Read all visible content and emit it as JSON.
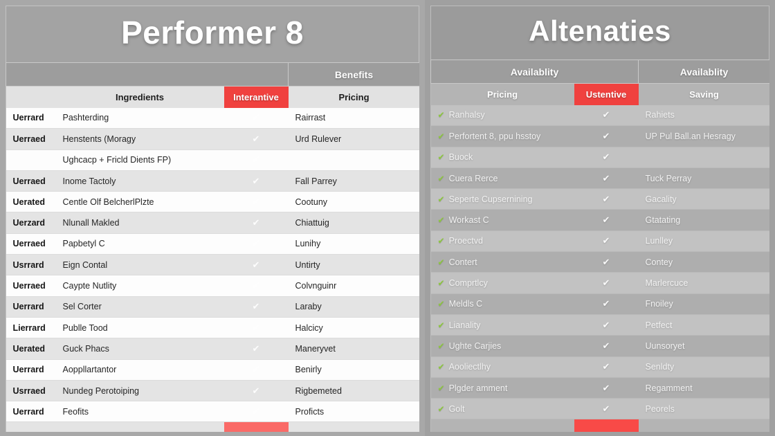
{
  "left_panel": {
    "title": "Performer 8",
    "group_headers": [
      {
        "label": "",
        "span": 3
      },
      {
        "label": "Benefits",
        "span": 1
      }
    ],
    "columns": [
      {
        "label": "",
        "key": "tag"
      },
      {
        "label": "Ingredients",
        "key": "ingredient"
      },
      {
        "label": "Interantive",
        "key": "check",
        "highlight": true,
        "color": "#f0413f"
      },
      {
        "label": "Pricing",
        "key": "pricing"
      }
    ],
    "check_glyph": "✔",
    "rows": [
      {
        "tag": "Uerrard",
        "ingredient": "Pashterding",
        "check": "✔",
        "pricing": "Rairrast"
      },
      {
        "tag": "Uerraed",
        "ingredient": "Henstents (Moragy",
        "check": "✔",
        "pricing": "Urd Rulever"
      },
      {
        "tag": "",
        "ingredient": "Ughcacp + Fricld Dients FP)",
        "check": "✔",
        "pricing": ""
      },
      {
        "tag": "Uerraed",
        "ingredient": "Inome Tactoly",
        "check": "✔",
        "pricing": "Fall Parrey"
      },
      {
        "tag": "Uerated",
        "ingredient": "Centle Olf BelcherlPlzte",
        "check": "✔",
        "pricing": "Cootuny"
      },
      {
        "tag": "Uerzard",
        "ingredient": "Nlunall Makled",
        "check": "✔",
        "pricing": "Chiattuig"
      },
      {
        "tag": "Uerraed",
        "ingredient": "Papbetyl C",
        "check": "✔",
        "pricing": "Lunihy"
      },
      {
        "tag": "Usrrard",
        "ingredient": "Eign Contal",
        "check": "✔",
        "pricing": "Untirty"
      },
      {
        "tag": "Uerraed",
        "ingredient": "Caypte Nutlity",
        "check": "✔",
        "pricing": "Colvnguinr"
      },
      {
        "tag": "Uerrard",
        "ingredient": "Sel Corter",
        "check": "✔",
        "pricing": "Laraby"
      },
      {
        "tag": "Lierrard",
        "ingredient": "Publle Tood",
        "check": "✔",
        "pricing": "Halcicy"
      },
      {
        "tag": "Uerated",
        "ingredient": "Guck Phacs",
        "check": "✔",
        "pricing": "Maneryvet"
      },
      {
        "tag": "Uerrard",
        "ingredient": "Aoppllartantor",
        "check": "✔",
        "pricing": "Benirly"
      },
      {
        "tag": "Usrraed",
        "ingredient": "Nundeg Perotoiping",
        "check": "✔",
        "pricing": "Rigbemeted"
      },
      {
        "tag": "Uerrard",
        "ingredient": "Feofits",
        "check": "✔",
        "pricing": "Proficts"
      }
    ]
  },
  "right_panel": {
    "title": "Altenaties",
    "group_headers": [
      {
        "label": "Availablity",
        "span": 2
      },
      {
        "label": "Availablity",
        "span": 1
      }
    ],
    "columns": [
      {
        "label": "Pricing",
        "key": "pricing"
      },
      {
        "label": "Ustentive",
        "key": "check",
        "highlight": true,
        "color": "#f0413f"
      },
      {
        "label": "Saving",
        "key": "saving"
      }
    ],
    "check_glyph": "✔",
    "green_check_glyph": "✔",
    "rows": [
      {
        "pricing": "Ranhalsy",
        "check": "✔",
        "saving": "Rahiets"
      },
      {
        "pricing": "Perfortent 8, ppu hsstoy",
        "check": "✔",
        "saving": "UP Pul Ball.an Hesragy"
      },
      {
        "pricing": "Buock",
        "check": "✔",
        "saving": ""
      },
      {
        "pricing": "Cuera Rerce",
        "check": "✔",
        "saving": "Tuck Perray"
      },
      {
        "pricing": "Seperte Cupsernining",
        "check": "✔",
        "saving": "Gacality"
      },
      {
        "pricing": "Workast C",
        "check": "✔",
        "saving": "Gtatating"
      },
      {
        "pricing": "Proectvd",
        "check": "✔",
        "saving": "Lunlley"
      },
      {
        "pricing": "Contert",
        "check": "✔",
        "saving": "Contey"
      },
      {
        "pricing": "Comprtlcy",
        "check": "✔",
        "saving": "Marlercuce"
      },
      {
        "pricing": "Meldls C",
        "check": "✔",
        "saving": "Fnoiley"
      },
      {
        "pricing": "Lianality",
        "check": "✔",
        "saving": "Petfect"
      },
      {
        "pricing": "Ughte Carjies",
        "check": "✔",
        "saving": "Uunsoryet"
      },
      {
        "pricing": "Aooliectlhy",
        "check": "✔",
        "saving": "Senldty"
      },
      {
        "pricing": "Plgder amment",
        "check": "✔",
        "saving": "Regamment"
      },
      {
        "pricing": "Golt",
        "check": "✔",
        "saving": "Peorels"
      }
    ]
  },
  "theme": {
    "accent_red": "#f0413f",
    "check_green": "#8cc63f",
    "panel_gray": "#a3a3a3",
    "title_color": "#ffffff"
  }
}
